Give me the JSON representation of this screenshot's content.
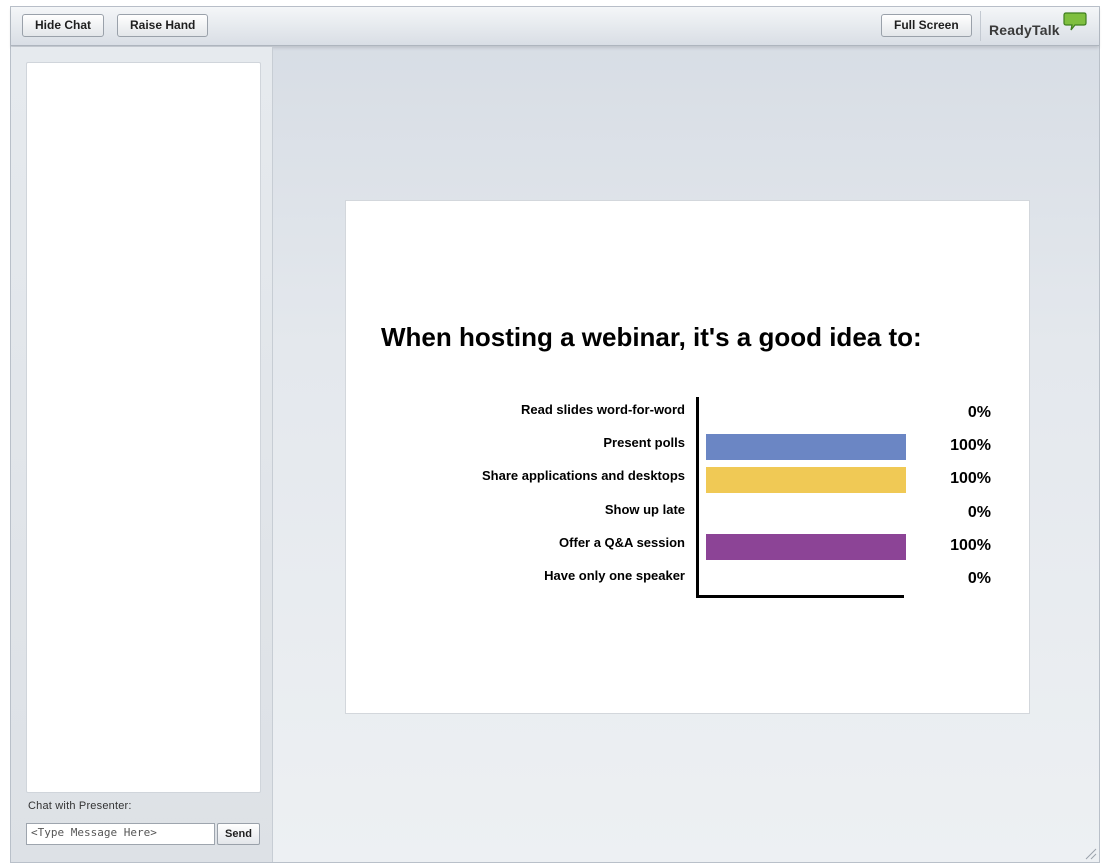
{
  "toolbar": {
    "hide_chat": "Hide Chat",
    "raise_hand": "Raise Hand",
    "full_screen": "Full Screen",
    "brand": "ReadyTalk"
  },
  "chat": {
    "label": "Chat with Presenter:",
    "input_placeholder": "<Type Message Here>",
    "send": "Send"
  },
  "slide": {
    "title": "When hosting a webinar, it's a good idea to:"
  },
  "chart_data": {
    "type": "bar",
    "orientation": "horizontal",
    "title": "When hosting a webinar, it's a good idea to:",
    "categories": [
      "Read slides word-for-word",
      "Present polls",
      "Share applications and desktops",
      "Show up late",
      "Offer a Q&A session",
      "Have only one speaker"
    ],
    "values": [
      0,
      100,
      100,
      0,
      100,
      0
    ],
    "value_labels": [
      "0%",
      "100%",
      "100%",
      "0%",
      "100%",
      "0%"
    ],
    "colors": [
      "#6b86c4",
      "#6b86c4",
      "#f0c955",
      "#f0c955",
      "#8c4496",
      "#8c4496"
    ],
    "xlim": [
      0,
      100
    ],
    "grid": false,
    "legend": "none"
  },
  "colors": {
    "brand_bubble": "#7fbf3f"
  }
}
